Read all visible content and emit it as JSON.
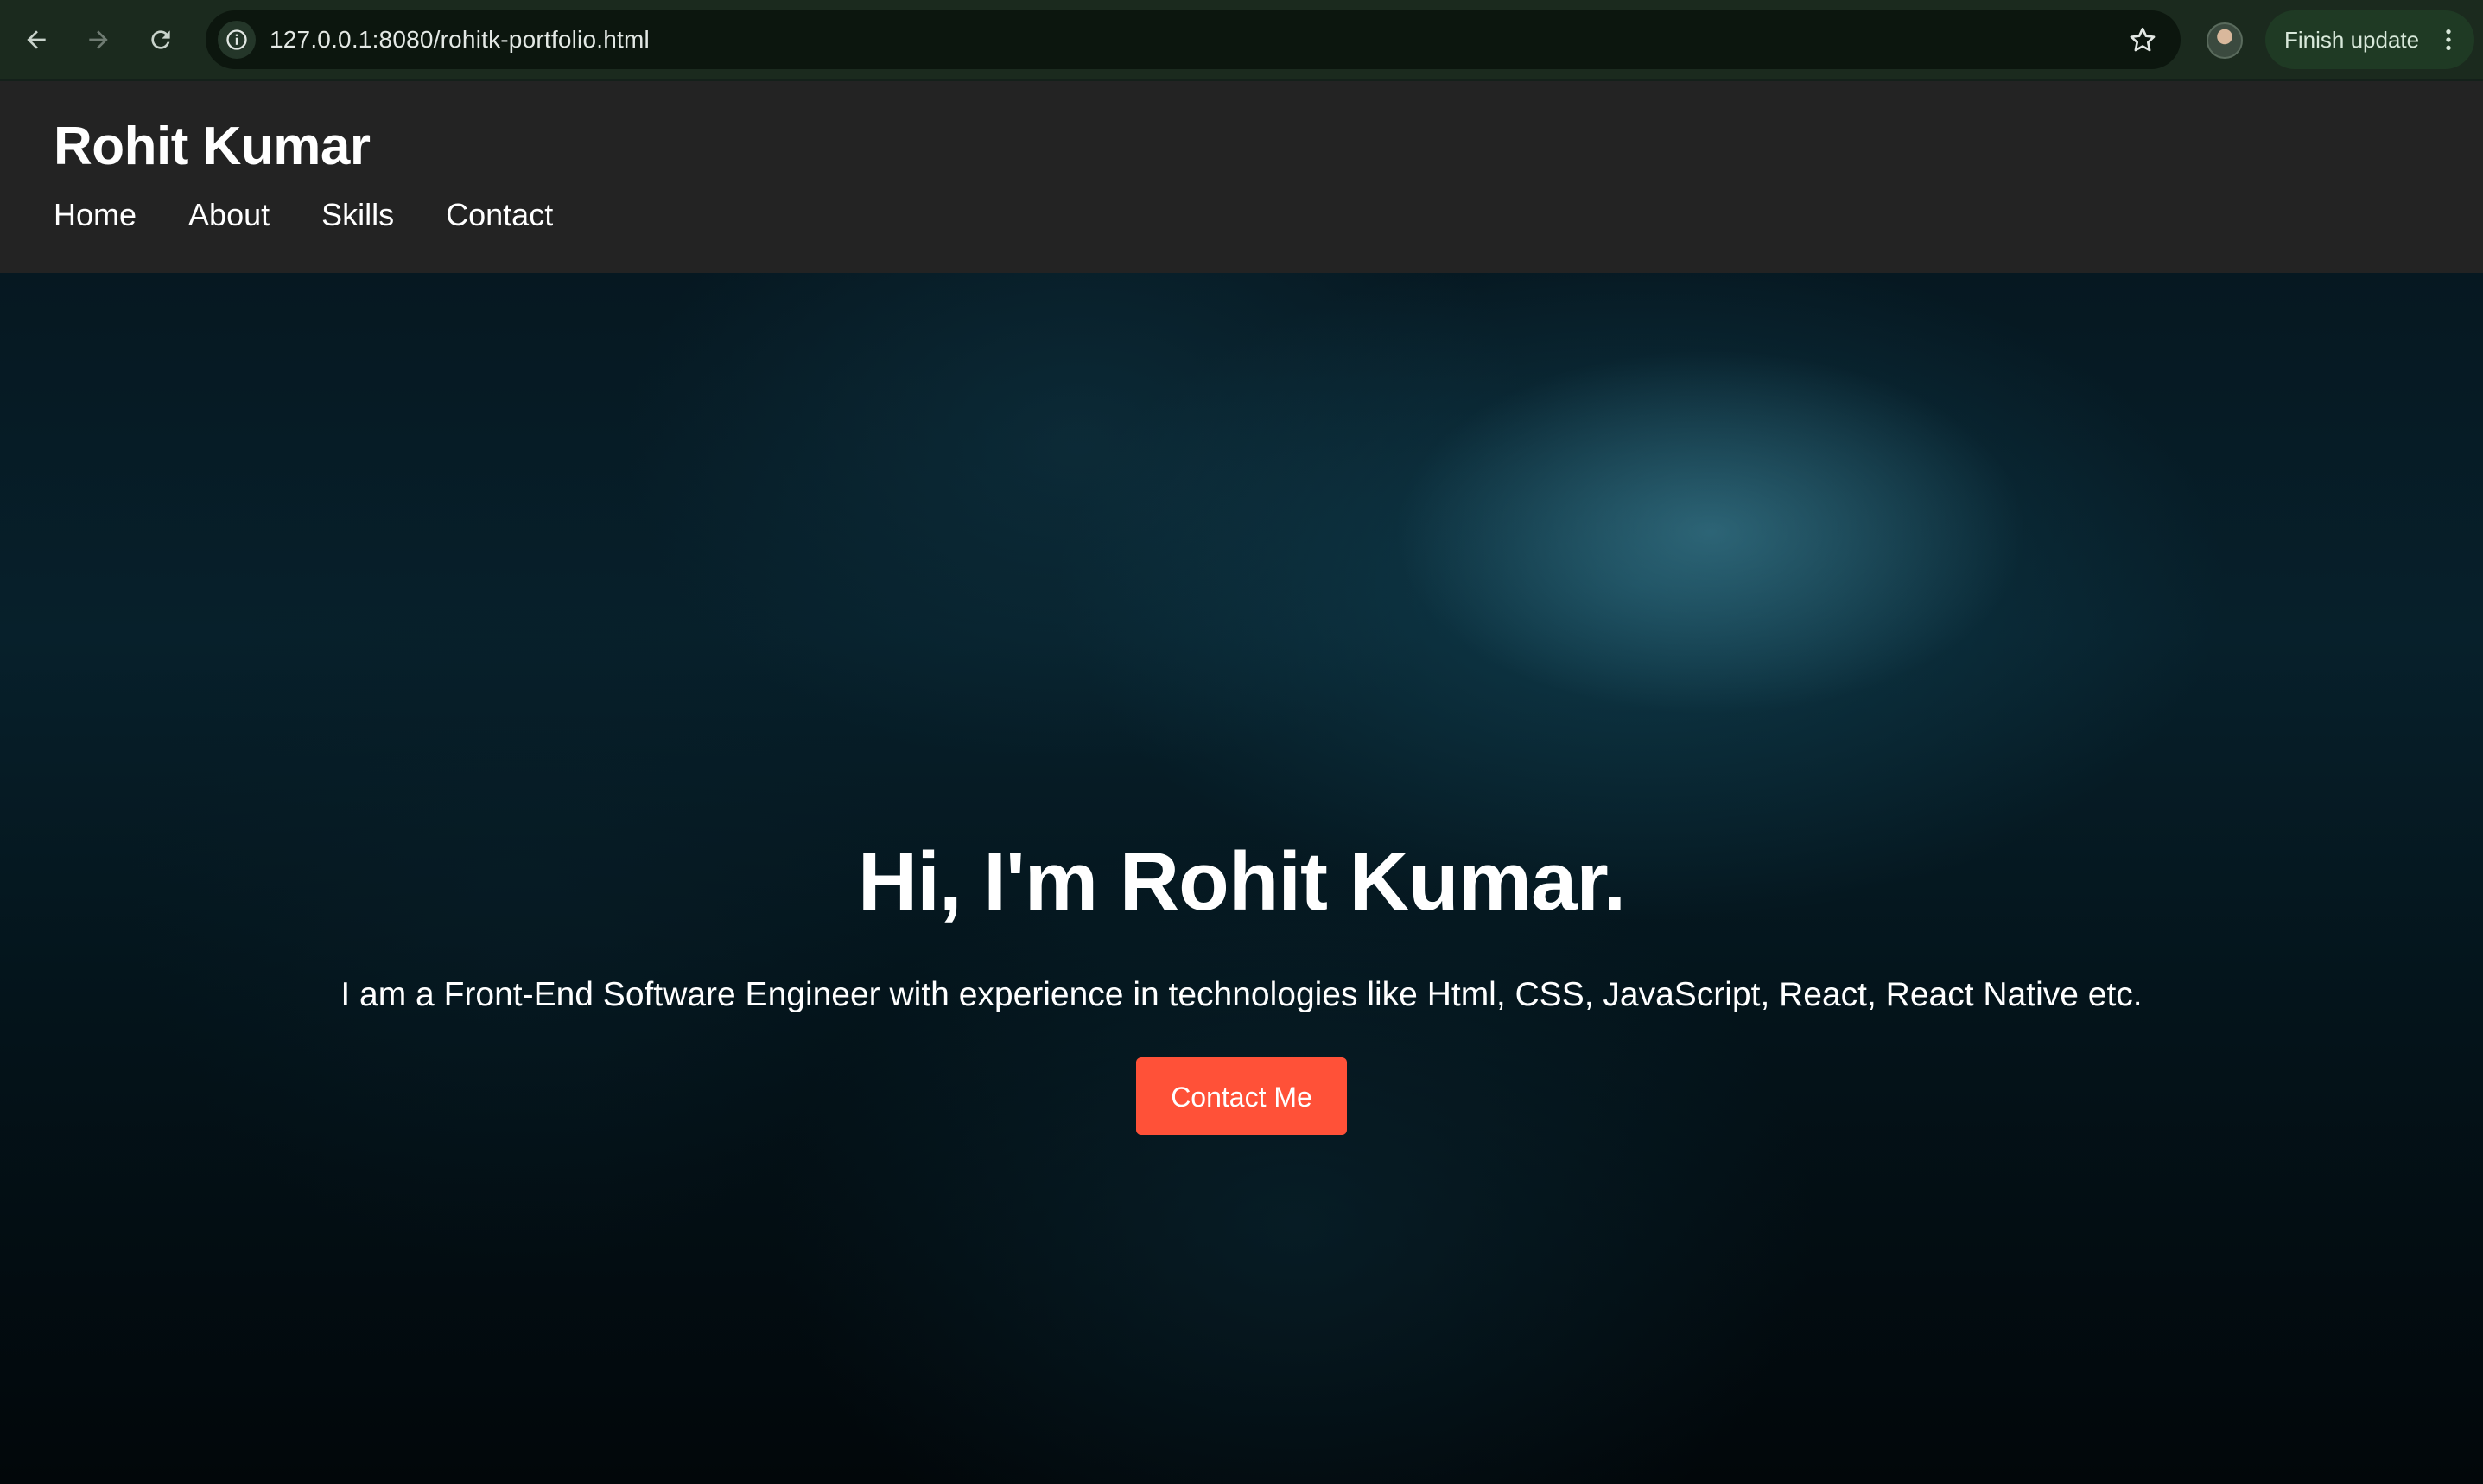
{
  "browser": {
    "url": "127.0.0.1:8080/rohitk-portfolio.html",
    "finish_update_label": "Finish update",
    "icons": [
      "back-arrow-icon",
      "forward-arrow-icon",
      "reload-icon",
      "site-info-icon",
      "star-icon",
      "profile-avatar",
      "more-vert-icon"
    ]
  },
  "header": {
    "logo": "Rohit Kumar",
    "nav": [
      "Home",
      "About",
      "Skills",
      "Contact"
    ]
  },
  "hero": {
    "title": "Hi, I'm Rohit Kumar.",
    "subtitle": "I am a Front-End Software Engineer with experience in technologies like Html, CSS, JavaScript, React, React Native etc.",
    "cta_label": "Contact Me"
  },
  "colors": {
    "browser_bar": "#1b2a1e",
    "header_bg": "#232323",
    "cta_bg": "#ff5138",
    "text": "#ffffff"
  }
}
